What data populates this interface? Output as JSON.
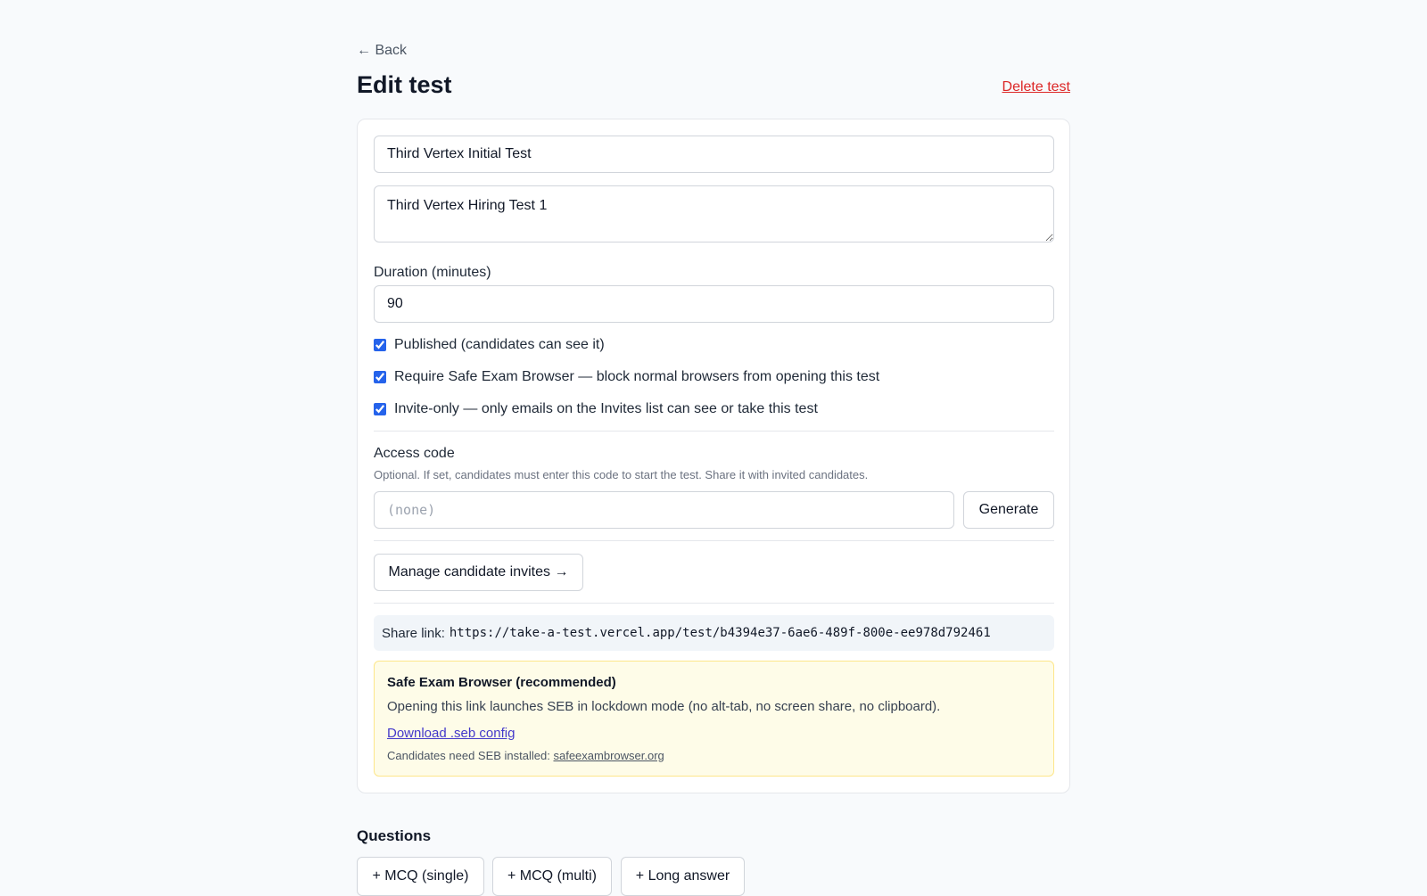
{
  "header": {
    "back_label": "← Back",
    "title": "Edit test",
    "delete_label": "Delete test"
  },
  "form": {
    "title_value": "Third Vertex Initial Test",
    "description_value": "Third Vertex Hiring Test 1",
    "duration_label": "Duration (minutes)",
    "duration_value": "90",
    "checkboxes": [
      {
        "label": "Published (candidates can see it)",
        "checked": true
      },
      {
        "label": "Require Safe Exam Browser — block normal browsers from opening this test",
        "checked": true
      },
      {
        "label": "Invite-only — only emails on the Invites list can see or take this test",
        "checked": true
      }
    ],
    "access_code": {
      "label": "Access code",
      "hint": "Optional. If set, candidates must enter this code to start the test. Share it with invited candidates.",
      "placeholder": "(none)",
      "value": "",
      "generate_label": "Generate"
    },
    "invites_label": "Manage candidate invites →"
  },
  "share": {
    "label": "Share link:",
    "url": "https://take-a-test.vercel.app/test/b4394e37-6ae6-489f-800e-ee978d792461"
  },
  "seb": {
    "title": "Safe Exam Browser (recommended)",
    "description": "Opening this link launches SEB in lockdown mode (no alt-tab, no screen share, no clipboard).",
    "download_label": "Download .seb config",
    "note_prefix": "Candidates need SEB installed:",
    "site_link": "safeexambrowser.org"
  },
  "questions": {
    "title": "Questions",
    "add_buttons": [
      "+ MCQ (single)",
      "+ MCQ (multi)",
      "+ Long answer"
    ]
  },
  "colors": {
    "background": "#f8fafc",
    "danger": "#dc2626",
    "accent": "#2563eb",
    "notice_bg": "#fefce8",
    "notice_border": "#fde68a",
    "link": "#4338ca"
  }
}
